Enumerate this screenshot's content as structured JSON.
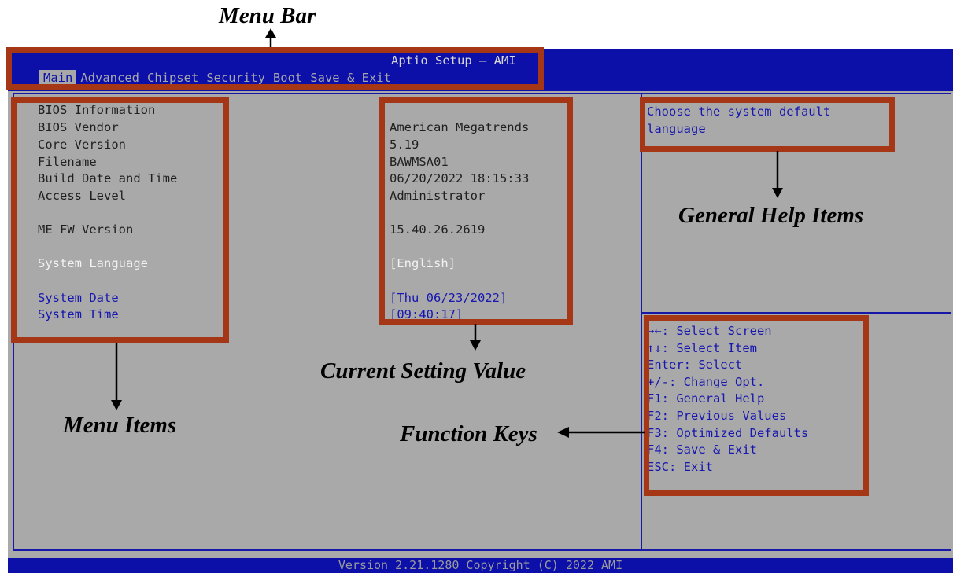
{
  "caption_top": "Menu Bar",
  "bios": {
    "title": "Aptio Setup – AMI",
    "tabs": [
      {
        "label": "Main",
        "active": true
      },
      {
        "label": "Advanced",
        "active": false
      },
      {
        "label": "Chipset",
        "active": false
      },
      {
        "label": "Security",
        "active": false
      },
      {
        "label": "Boot",
        "active": false
      },
      {
        "label": "Save & Exit",
        "active": false
      }
    ],
    "items": [
      {
        "label": "BIOS Information",
        "value": ""
      },
      {
        "label": "BIOS Vendor",
        "value": "American Megatrends"
      },
      {
        "label": "Core Version",
        "value": "5.19"
      },
      {
        "label": "Filename",
        "value": "BAWMSA01"
      },
      {
        "label": "Build Date and Time",
        "value": "06/20/2022 18:15:33"
      },
      {
        "label": "Access Level",
        "value": "Administrator"
      },
      {
        "label": "ME FW Version",
        "value": "15.40.26.2619"
      },
      {
        "label": "System Language",
        "value": "[English]"
      },
      {
        "label": "System Date",
        "value": "[Thu 06/23/2022]"
      },
      {
        "label": "System Time",
        "value": "[09:40:17]"
      }
    ],
    "help_text": [
      "Choose the system default",
      "language"
    ],
    "function_keys": [
      "→←: Select Screen",
      "↑↓: Select Item",
      "Enter: Select",
      "+/-: Change Opt.",
      "F1: General Help",
      "F2: Previous Values",
      "F3: Optimized Defaults",
      "F4: Save & Exit",
      "ESC: Exit"
    ],
    "version": "Version 2.21.1280 Copyright (C) 2022 AMI"
  },
  "annotations": {
    "menu_bar": "Menu Bar",
    "menu_items": "Menu Items",
    "current_setting_value": "Current Setting Value",
    "general_help_items": "General Help Items",
    "function_keys": "Function Keys"
  },
  "colors": {
    "bios_blue": "#0c10a8",
    "bios_gray": "#a9a9a9",
    "highlight_white": "#f2f2f2",
    "selectable_blue": "#1616b0",
    "annotation_box": "#a53616"
  }
}
